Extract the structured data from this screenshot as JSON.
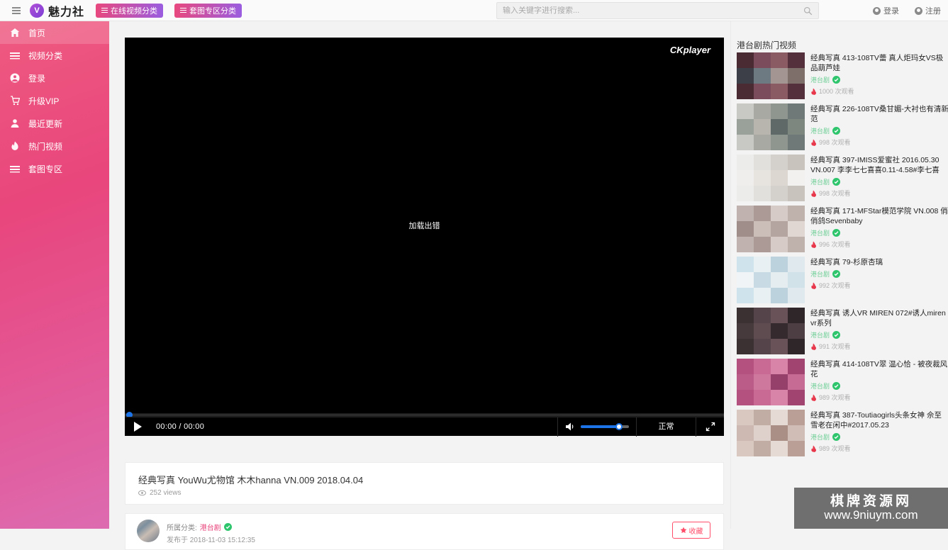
{
  "header": {
    "menu_icon": "hamburger-icon",
    "brand_mark": "V",
    "brand_name": "魅力社",
    "nav_buttons": [
      {
        "label": "在线视频分类",
        "icon": "list-icon"
      },
      {
        "label": "套图专区分类",
        "icon": "list-icon"
      }
    ],
    "search": {
      "placeholder": "输入关键字进行搜索...",
      "value": "",
      "icon": "search-icon"
    },
    "user_links": [
      {
        "label": "登录",
        "icon": "user-icon"
      },
      {
        "label": "注册",
        "icon": "user-plus-icon"
      }
    ]
  },
  "sidebar": {
    "items": [
      {
        "label": "首页",
        "icon": "home-icon",
        "active": true
      },
      {
        "label": "视频分类",
        "icon": "list-icon",
        "active": false
      },
      {
        "label": "登录",
        "icon": "user-icon",
        "active": false
      },
      {
        "label": "升级VIP",
        "icon": "cart-icon",
        "active": false
      },
      {
        "label": "最近更新",
        "icon": "person-icon",
        "active": false
      },
      {
        "label": "热门视频",
        "icon": "fire-icon",
        "active": false
      },
      {
        "label": "套图专区",
        "icon": "list-icon",
        "active": false
      }
    ]
  },
  "player": {
    "watermark": "CKplayer",
    "error_message": "加载出错",
    "time_display": "00:00 / 00:00",
    "quality_label": "正常",
    "play_icon": "play-icon",
    "volume_icon": "volume-icon",
    "fullscreen_icon": "fullscreen-icon",
    "progress_percent": 0,
    "volume_percent": 78
  },
  "video_info": {
    "title": "经典写真 YouWu尤物馆 木木hanna VN.009 2018.04.04",
    "views": "252 views",
    "views_icon": "eye-icon"
  },
  "author": {
    "avatar": "avatar",
    "category_prefix": "所属分类:",
    "category": "港台剧",
    "verified_icon": "verified-check-icon",
    "date_prefix": "发布于",
    "date": "2018-11-03 15:12:35",
    "favorite": {
      "label": "收藏",
      "icon": "star-icon"
    }
  },
  "rail": {
    "title": "港台剧热门视频",
    "items": [
      {
        "name": "经典写真 413-108TV蕾 真人炬玛女VS极品葫芦娃",
        "category": "港台剧",
        "views": "1000 次观看",
        "thumb_colors": [
          "#4a2b33",
          "#7a4c5c",
          "#8a5b62",
          "#53303b",
          "#3d3f48",
          "#6d7a82",
          "#a39692",
          "#7f6f6b"
        ]
      },
      {
        "name": "经典写真 226-108TV桑甘媚-大衬也有清新范",
        "category": "港台剧",
        "views": "998 次观看",
        "thumb_colors": [
          "#c8c8c4",
          "#a9a9a4",
          "#8f9690",
          "#6f7a78",
          "#9aa09a",
          "#b7b5ae",
          "#5f6a68",
          "#7e8680"
        ]
      },
      {
        "name": "经典写真 397-IMISS爱蜜社 2016.05.30 VN.007 李李七七喜喜0.11-4.58#李七喜",
        "category": "港台剧",
        "views": "998 次观看",
        "thumb_colors": [
          "#ececea",
          "#e2e0dc",
          "#d4d0cb",
          "#c9c3bd",
          "#efeeec",
          "#e7e4e0",
          "#dcd7d1",
          "#f2f1ef"
        ]
      },
      {
        "name": "经典写真 171-MFStar模范学院 VN.008 俏俏鸽Sevenbaby",
        "category": "港台剧",
        "views": "996 次观看",
        "thumb_colors": [
          "#c0b2ae",
          "#ab9a96",
          "#d6cbc6",
          "#bfb2ad",
          "#9f8e8a",
          "#cbbdb8",
          "#b5a5a1",
          "#e0d6d2"
        ]
      },
      {
        "name": "经典写真 79-杉原杏璃",
        "category": "港台剧",
        "views": "992 次观看",
        "thumb_colors": [
          "#cfe3ec",
          "#e8f0f4",
          "#bcd3de",
          "#dfe9ee",
          "#f1f4f6",
          "#c8dbe4",
          "#e5edf1",
          "#d2e2e9"
        ]
      },
      {
        "name": "经典写真 诱人VR MIREN 072#诱人miren vr系列",
        "category": "港台剧",
        "views": "991 次观看",
        "thumb_colors": [
          "#3b3133",
          "#55454a",
          "#6a5358",
          "#2e2628",
          "#473a3d",
          "#5e4c50",
          "#352b2e",
          "#4c3e42"
        ]
      },
      {
        "name": "经典写真 414-108TV翠 温心恰 - 被夜裁风花",
        "category": "港台剧",
        "views": "989 次观看",
        "thumb_colors": [
          "#b4517f",
          "#c96a94",
          "#d884a8",
          "#a14570",
          "#bb5c88",
          "#cf789e",
          "#95406a",
          "#c66b93"
        ]
      },
      {
        "name": "经典写真 387-Toutiaogirls头条女神 佘至雪老在闲中#2017.05.23",
        "category": "港台剧",
        "views": "989 次观看",
        "thumb_colors": [
          "#d8c8c0",
          "#c2ada4",
          "#e6dad4",
          "#b99f96",
          "#cdb9b1",
          "#ded0ca",
          "#a98f86",
          "#d0bdb5"
        ]
      }
    ]
  },
  "watermark": {
    "cn": "棋牌资源网",
    "url": "www.9niuym.com"
  }
}
